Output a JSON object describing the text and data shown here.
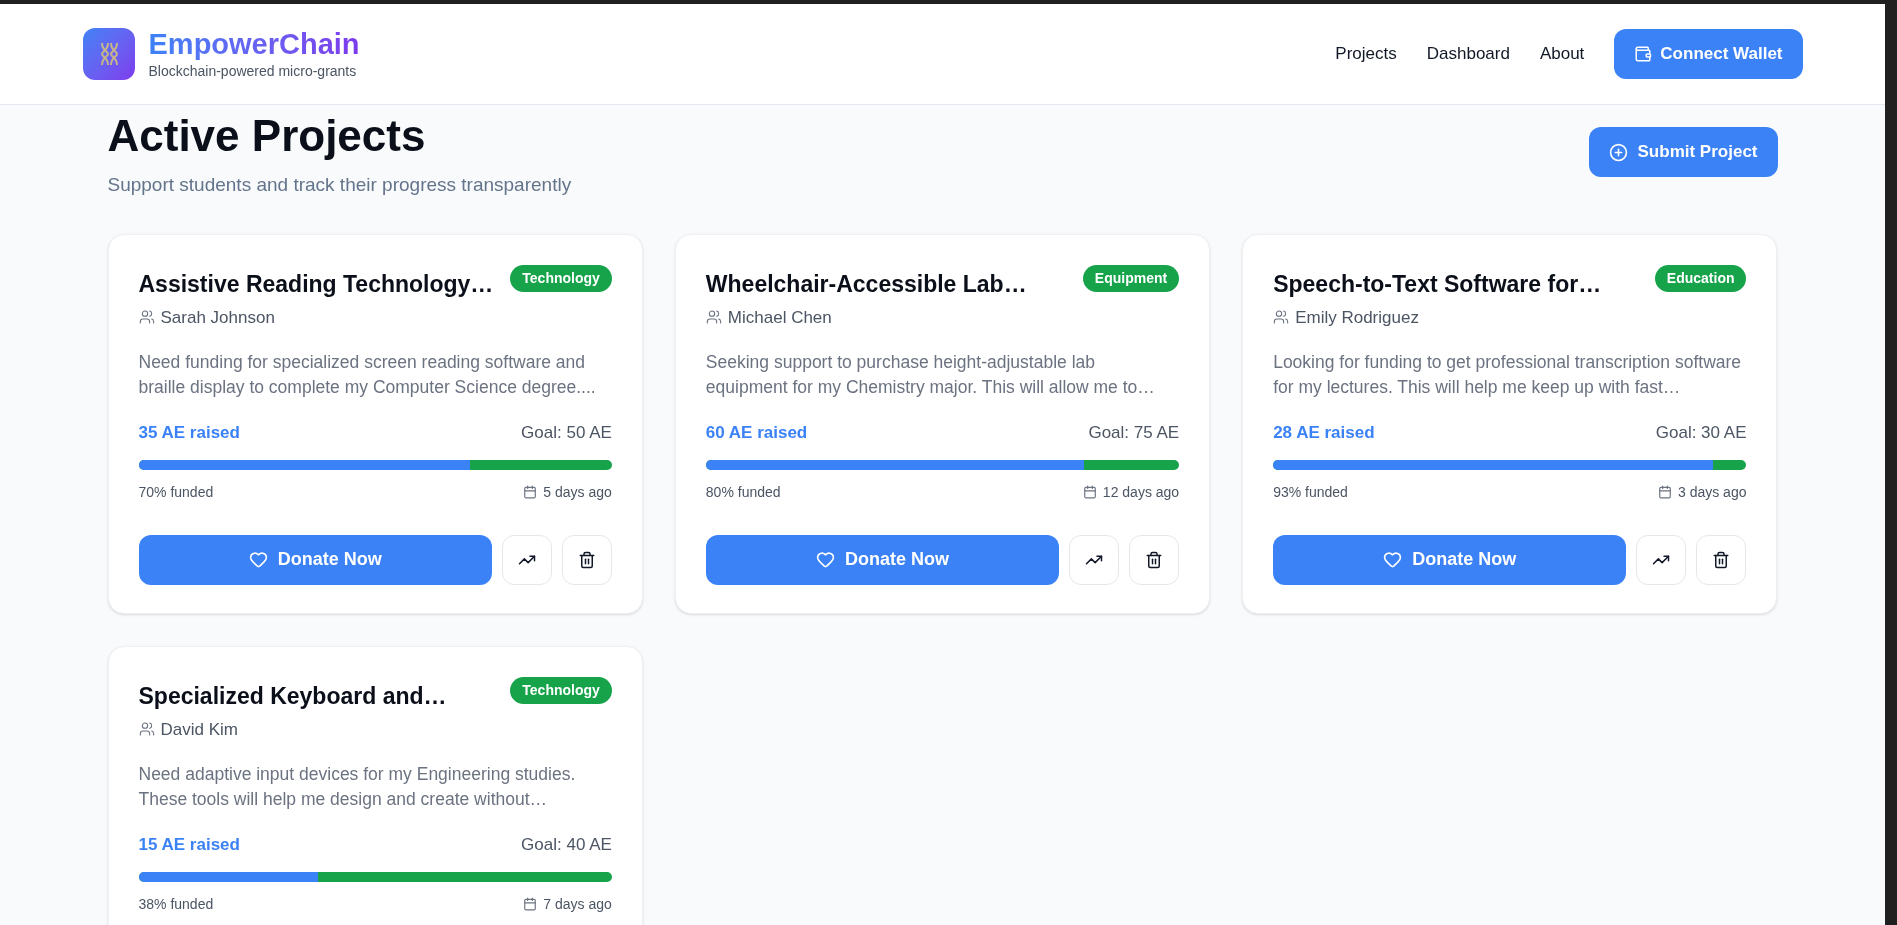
{
  "header": {
    "brand": "EmpowerChain",
    "tagline": "Blockchain-powered micro-grants",
    "nav": [
      "Projects",
      "Dashboard",
      "About"
    ],
    "connect_button": "Connect Wallet"
  },
  "page": {
    "title": "Active Projects",
    "subtitle": "Support students and track their progress transparently",
    "submit_button": "Submit Project"
  },
  "projects": [
    {
      "title": "Assistive Reading Technology…",
      "category": "Technology",
      "author": "Sarah Johnson",
      "description": "Need funding for specialized screen reading software and braille display to complete my Computer Science degree....",
      "raised": "35 AE raised",
      "goal": "Goal: 50 AE",
      "level": 0.7,
      "funded": "70% funded",
      "posted": "5 days ago",
      "donate_button": "Donate Now"
    },
    {
      "title": "Wheelchair-Accessible Lab…",
      "category": "Equipment",
      "author": "Michael Chen",
      "description": "Seeking support to purchase height-adjustable lab equipment for my Chemistry major. This will allow me to…",
      "raised": "60 AE raised",
      "goal": "Goal: 75 AE",
      "level": 0.8,
      "funded": "80% funded",
      "posted": "12 days ago",
      "donate_button": "Donate Now"
    },
    {
      "title": "Speech-to-Text Software for…",
      "category": "Education",
      "author": "Emily Rodriguez",
      "description": "Looking for funding to get professional transcription software for my lectures. This will help me keep up with fast…",
      "raised": "28 AE raised",
      "goal": "Goal: 30 AE",
      "level": 0.93,
      "funded": "93% funded",
      "posted": "3 days ago",
      "donate_button": "Donate Now"
    },
    {
      "title": "Specialized Keyboard and…",
      "category": "Technology",
      "author": "David Kim",
      "description": "Need adaptive input devices for my Engineering studies. These tools will help me design and create without…",
      "raised": "15 AE raised",
      "goal": "Goal: 40 AE",
      "level": 0.38,
      "funded": "38% funded",
      "posted": "7 days ago"
    }
  ]
}
